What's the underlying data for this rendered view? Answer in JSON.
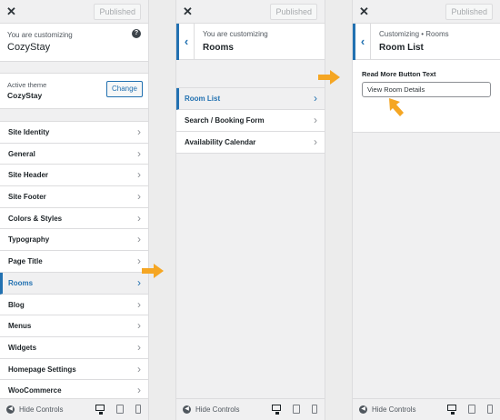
{
  "panel1": {
    "published_label": "Published",
    "customizing_label": "You are customizing",
    "site_name": "CozyStay",
    "active_theme_label": "Active theme",
    "active_theme_name": "CozyStay",
    "change_label": "Change",
    "menu": [
      {
        "label": "Site Identity"
      },
      {
        "label": "General"
      },
      {
        "label": "Site Header"
      },
      {
        "label": "Site Footer"
      },
      {
        "label": "Colors & Styles"
      },
      {
        "label": "Typography"
      },
      {
        "label": "Page Title"
      },
      {
        "label": "Rooms"
      },
      {
        "label": "Blog"
      },
      {
        "label": "Menus"
      },
      {
        "label": "Widgets"
      },
      {
        "label": "Homepage Settings"
      },
      {
        "label": "WooCommerce"
      }
    ],
    "hide_controls": "Hide Controls"
  },
  "panel2": {
    "published_label": "Published",
    "customizing_label": "You are customizing",
    "section_title": "Rooms",
    "menu": [
      {
        "label": "Room List"
      },
      {
        "label": "Search / Booking Form"
      },
      {
        "label": "Availability Calendar"
      }
    ],
    "hide_controls": "Hide Controls"
  },
  "panel3": {
    "published_label": "Published",
    "breadcrumb": "Customizing • Rooms",
    "section_title": "Room List",
    "field_label": "Read More Button Text",
    "field_value": "View Room Details",
    "hide_controls": "Hide Controls"
  },
  "icons": {
    "close": "close-icon",
    "back": "chevron-left-icon",
    "chevron": "chevron-right-icon",
    "help": "help-icon",
    "arrow": "arrow-right-icon",
    "desktop": "desktop-icon",
    "tablet": "tablet-icon",
    "mobile": "mobile-icon"
  },
  "colors": {
    "accent": "#2271b1",
    "arrow": "#f5a623"
  }
}
